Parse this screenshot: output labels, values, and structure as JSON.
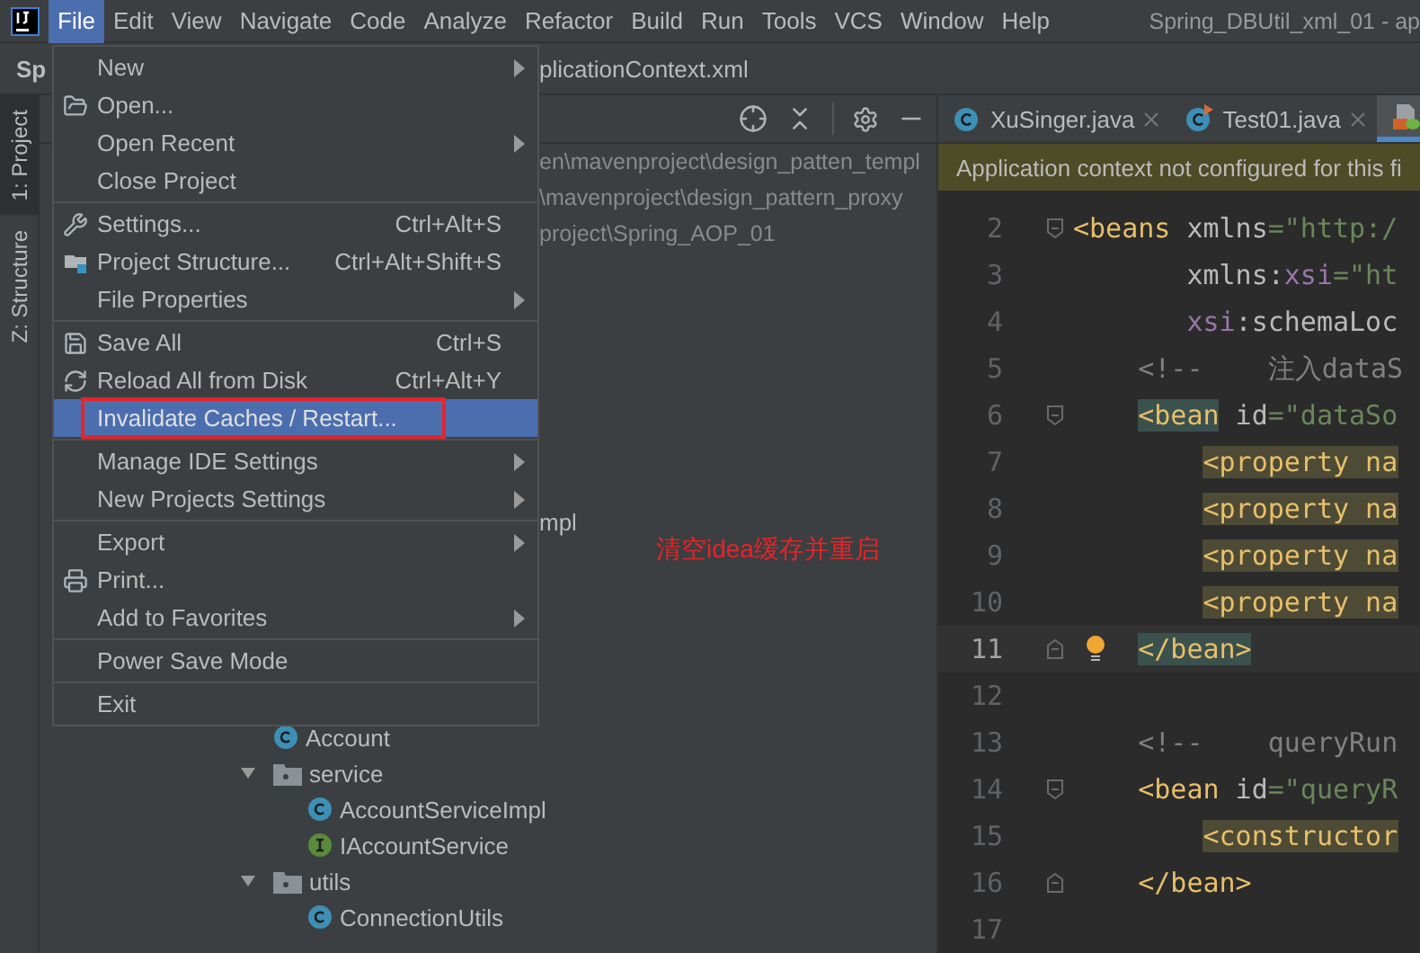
{
  "menu_bar": {
    "items": [
      {
        "label": "File",
        "selected": true
      },
      {
        "label": "Edit",
        "selected": false
      },
      {
        "label": "View",
        "selected": false
      },
      {
        "label": "Navigate",
        "selected": false
      },
      {
        "label": "Code",
        "selected": false
      },
      {
        "label": "Analyze",
        "selected": false
      },
      {
        "label": "Refactor",
        "selected": false
      },
      {
        "label": "Build",
        "selected": false
      },
      {
        "label": "Run",
        "selected": false
      },
      {
        "label": "Tools",
        "selected": false
      },
      {
        "label": "VCS",
        "selected": false
      },
      {
        "label": "Window",
        "selected": false
      },
      {
        "label": "Help",
        "selected": false
      }
    ],
    "title": "Spring_DBUtil_xml_01 - ap"
  },
  "nav_bar": {
    "project": "Sp",
    "file": "plicationContext.xml"
  },
  "tool_strip": [
    {
      "label": "1: Project",
      "selected": true
    },
    {
      "label": "Z: Structure",
      "selected": false
    }
  ],
  "project_tree": {
    "paths": [
      "en\\mavenproject\\design_patten_templ",
      "\\mavenproject\\design_pattern_proxy",
      "project\\Spring_AOP_01"
    ],
    "fragment": "mpl",
    "items": [
      {
        "kind": "class",
        "label": "Account"
      },
      {
        "kind": "folder",
        "label": "service",
        "expanded": true,
        "children": [
          {
            "kind": "class",
            "label": "AccountServiceImpl"
          },
          {
            "kind": "interface",
            "label": "IAccountService"
          }
        ]
      },
      {
        "kind": "folder",
        "label": "utils",
        "expanded": true,
        "children": [
          {
            "kind": "class",
            "label": "ConnectionUtils"
          }
        ]
      }
    ]
  },
  "file_menu": {
    "groups": [
      [
        {
          "label": "New",
          "submenu": true,
          "selected": false
        },
        {
          "label": "Open...",
          "kind": "open",
          "submenu": false,
          "selected": false
        },
        {
          "label": "Open Recent",
          "submenu": true,
          "selected": false
        },
        {
          "label": "Close Project",
          "submenu": false,
          "selected": false
        }
      ],
      [
        {
          "label": "Settings...",
          "kind": "settings",
          "shortcut": "Ctrl+Alt+S",
          "submenu": false,
          "selected": false
        },
        {
          "label": "Project Structure...",
          "kind": "structure",
          "shortcut": "Ctrl+Alt+Shift+S",
          "submenu": false,
          "selected": false
        },
        {
          "label": "File Properties",
          "submenu": true,
          "selected": false
        }
      ],
      [
        {
          "label": "Save All",
          "kind": "save",
          "shortcut": "Ctrl+S",
          "submenu": false,
          "selected": false
        },
        {
          "label": "Reload All from Disk",
          "kind": "reload",
          "shortcut": "Ctrl+Alt+Y",
          "submenu": false,
          "selected": false
        },
        {
          "label": "Invalidate Caches / Restart...",
          "submenu": false,
          "selected": true
        }
      ],
      [
        {
          "label": "Manage IDE Settings",
          "submenu": true,
          "selected": false
        },
        {
          "label": "New Projects Settings",
          "submenu": true,
          "selected": false
        }
      ],
      [
        {
          "label": "Export",
          "submenu": true,
          "selected": false
        },
        {
          "label": "Print...",
          "kind": "print",
          "submenu": false,
          "selected": false
        },
        {
          "label": "Add to Favorites",
          "submenu": true,
          "selected": false
        }
      ],
      [
        {
          "label": "Power Save Mode",
          "submenu": false,
          "selected": false
        }
      ],
      [
        {
          "label": "Exit",
          "submenu": false,
          "selected": false
        }
      ]
    ]
  },
  "annotation": {
    "note": "清空idea缓存并重启"
  },
  "editor": {
    "tabs": [
      {
        "label": "XuSinger.java",
        "kind": "class",
        "selected": false
      },
      {
        "label": "Test01.java",
        "kind": "runnable",
        "selected": false
      },
      {
        "kind": "xml",
        "selected": true
      }
    ],
    "notice": "Application context not configured for this fi",
    "lines": [
      {
        "number": "2",
        "kind": "top",
        "fold_start": true,
        "current": false,
        "segments": [
          {
            "kind": "tag",
            "text": "<beans"
          },
          {
            "kind": "attr",
            "text": " xmlns"
          },
          {
            "kind": "string",
            "text": "=\"http:/"
          }
        ]
      },
      {
        "number": "3",
        "kind": "attribute",
        "current": false,
        "segments": [
          {
            "kind": "attr",
            "text": "xmlns:"
          },
          {
            "kind": "ns",
            "text": "xsi"
          },
          {
            "kind": "string",
            "text": "=\"ht"
          }
        ]
      },
      {
        "number": "4",
        "kind": "attribute",
        "current": false,
        "segments": [
          {
            "kind": "ns",
            "text": "xsi"
          },
          {
            "kind": "attr",
            "text": ":schemaLoc"
          }
        ]
      },
      {
        "number": "5",
        "kind": "block",
        "current": false,
        "segments": [
          {
            "kind": "comment",
            "text": "<!--    注入dataS"
          }
        ]
      },
      {
        "number": "6",
        "kind": "block",
        "fold_start": true,
        "current": false,
        "segments": [
          {
            "kind": "tag",
            "text": "<bean",
            "matched": true
          },
          {
            "kind": "attr",
            "text": " id"
          },
          {
            "kind": "string",
            "text": "=\"dataSo"
          }
        ]
      },
      {
        "number": "7",
        "kind": "nested",
        "current": false,
        "segments": [
          {
            "kind": "tag",
            "text": "<property na",
            "in_scope": true
          }
        ]
      },
      {
        "number": "8",
        "kind": "nested",
        "current": false,
        "segments": [
          {
            "kind": "tag",
            "text": "<property na",
            "in_scope": true
          }
        ]
      },
      {
        "number": "9",
        "kind": "nested",
        "current": false,
        "segments": [
          {
            "kind": "tag",
            "text": "<property na",
            "in_scope": true
          }
        ]
      },
      {
        "number": "10",
        "kind": "nested",
        "current": false,
        "segments": [
          {
            "kind": "tag",
            "text": "<property na",
            "in_scope": true
          }
        ]
      },
      {
        "number": "11",
        "kind": "block",
        "fold_end": true,
        "current": true,
        "bulb": true,
        "segments": [
          {
            "kind": "tag",
            "text": "</bean>",
            "matched": true
          }
        ]
      },
      {
        "number": "12",
        "kind": "blank",
        "current": false
      },
      {
        "number": "13",
        "kind": "block",
        "current": false,
        "segments": [
          {
            "kind": "comment",
            "text": "<!--    queryRun"
          }
        ]
      },
      {
        "number": "14",
        "kind": "block",
        "fold_start": true,
        "current": false,
        "segments": [
          {
            "kind": "tag",
            "text": "<bean"
          },
          {
            "kind": "attr",
            "text": " id"
          },
          {
            "kind": "string",
            "text": "=\"queryR"
          }
        ]
      },
      {
        "number": "15",
        "kind": "nested",
        "current": false,
        "segments": [
          {
            "kind": "tag",
            "text": "<constructor",
            "in_scope": true
          }
        ]
      },
      {
        "number": "16",
        "kind": "block",
        "fold_end": true,
        "current": false,
        "segments": [
          {
            "kind": "tag",
            "text": "</bean>"
          }
        ]
      },
      {
        "number": "17",
        "kind": "blank",
        "current": false
      }
    ]
  }
}
